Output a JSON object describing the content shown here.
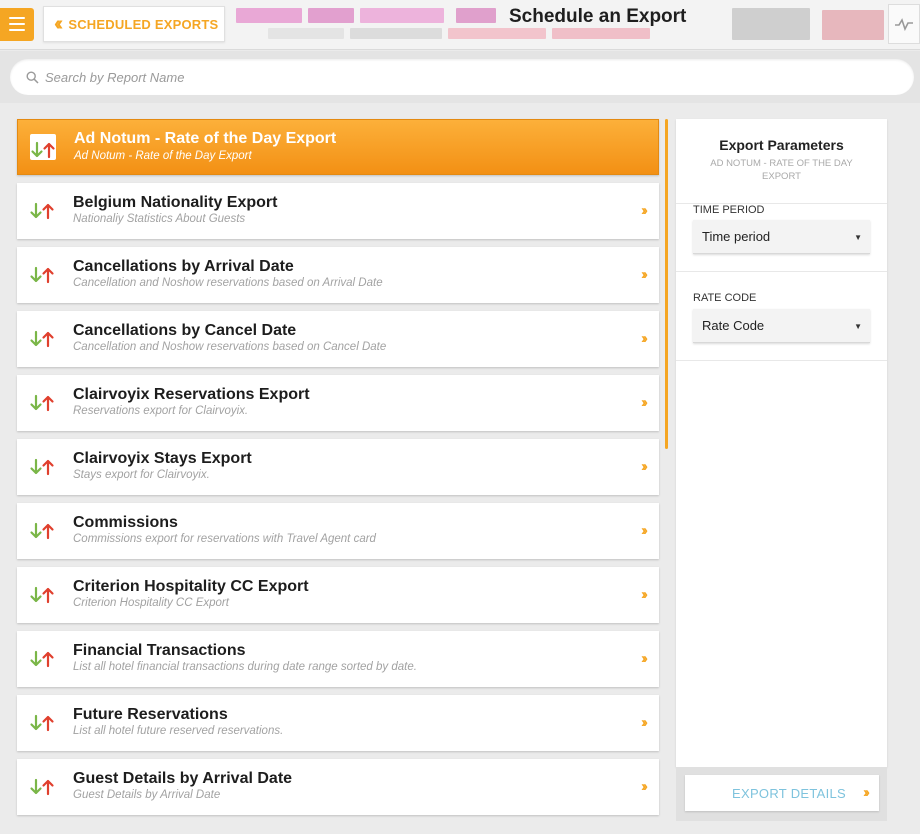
{
  "header": {
    "back_label": "SCHEDULED EXPORTS",
    "title": "Schedule an Export",
    "menu_icon": "hamburger-icon",
    "back_icon": "double-chevron-left-icon",
    "activity_icon": "activity-icon"
  },
  "search": {
    "placeholder": "Search by Report Name",
    "value": ""
  },
  "reports": [
    {
      "name": "Ad Notum - Rate of the Day Export",
      "description": "Ad Notum - Rate of the Day Export",
      "selected": true
    },
    {
      "name": "Belgium Nationality Export",
      "description": "Nationaliy Statistics About Guests",
      "selected": false
    },
    {
      "name": "Cancellations by Arrival Date",
      "description": "Cancellation and Noshow reservations based on Arrival Date",
      "selected": false
    },
    {
      "name": "Cancellations by Cancel Date",
      "description": "Cancellation and Noshow reservations based on Cancel Date",
      "selected": false
    },
    {
      "name": "Clairvoyix Reservations Export",
      "description": "Reservations export for Clairvoyix.",
      "selected": false
    },
    {
      "name": "Clairvoyix Stays Export",
      "description": "Stays export for Clairvoyix.",
      "selected": false
    },
    {
      "name": "Commissions",
      "description": "Commissions export for reservations with Travel Agent card",
      "selected": false
    },
    {
      "name": "Criterion Hospitality CC Export",
      "description": "Criterion Hospitality CC Export",
      "selected": false
    },
    {
      "name": "Financial Transactions",
      "description": "List all hotel financial transactions during date range sorted by date.",
      "selected": false
    },
    {
      "name": "Future Reservations",
      "description": "List all hotel future reserved reservations.",
      "selected": false
    },
    {
      "name": "Guest Details by Arrival Date",
      "description": "Guest Details by Arrival Date",
      "selected": false
    }
  ],
  "parameters": {
    "title": "Export Parameters",
    "subtitle": "AD NOTUM - RATE OF THE DAY EXPORT",
    "fields": [
      {
        "label": "TIME PERIOD",
        "value": "Time period"
      },
      {
        "label": "RATE CODE",
        "value": "Rate Code"
      }
    ],
    "details_label": "EXPORT DETAILS"
  },
  "colors": {
    "accent": "#f5a623",
    "arrow_down": "#7ab648",
    "arrow_up": "#e0402e",
    "link_blue": "#7ec3dd"
  }
}
